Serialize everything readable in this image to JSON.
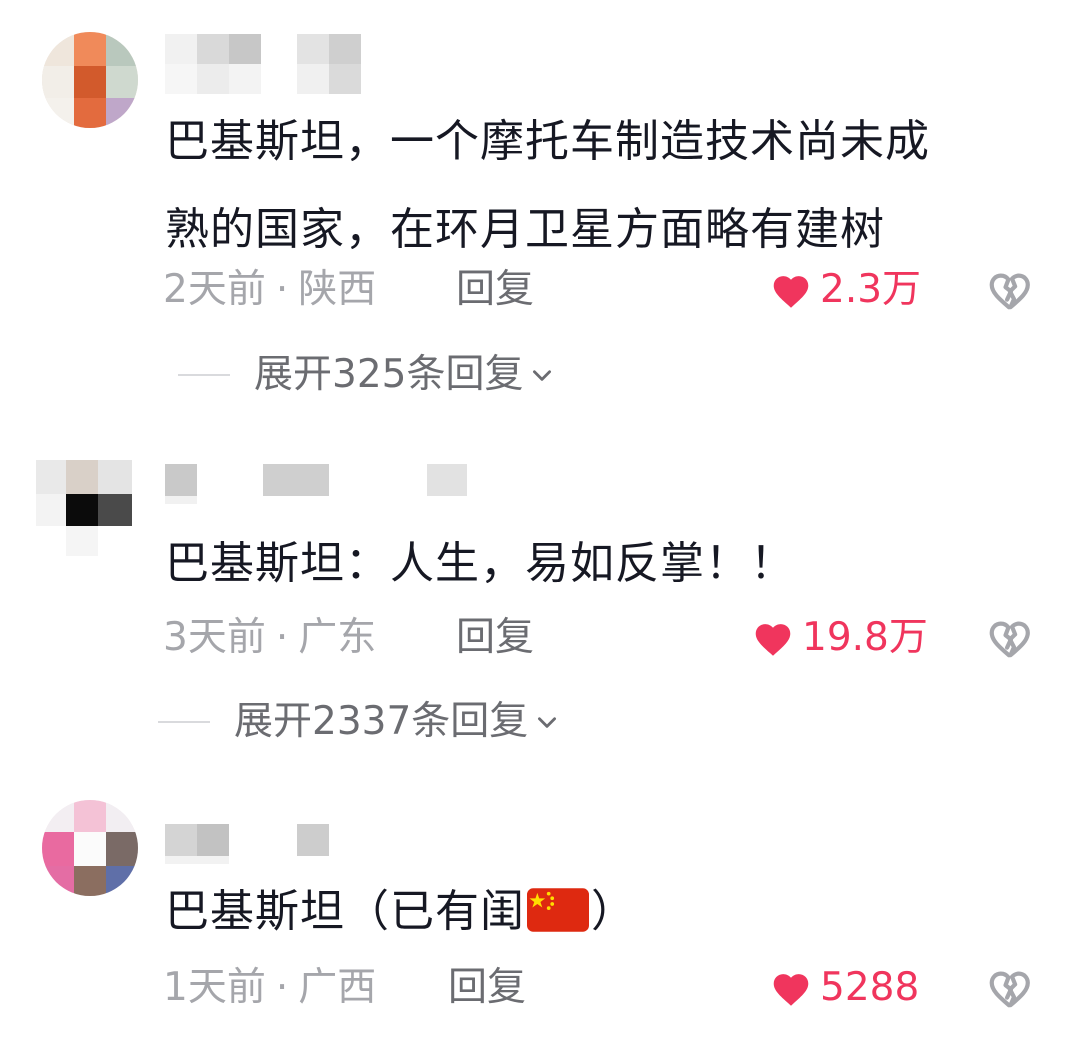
{
  "colors": {
    "like": "#f0355d",
    "meta": "#a5a6ab",
    "reply": "#6b6c71",
    "text": "#161823"
  },
  "comments": [
    {
      "content_lines": [
        "巴基斯坦，一个摩托车制造技术尚未成",
        "熟的国家，在环月卫星方面略有建树"
      ],
      "time": "2天前",
      "separator": "·",
      "location": "陕西",
      "reply_label": "回复",
      "likes": "2.3万",
      "expand_label": "展开325条回复",
      "like_icon": "heart-icon",
      "dislike_icon": "broken-heart-icon"
    },
    {
      "content_lines": [
        "巴基斯坦：人生，易如反掌！！"
      ],
      "time": "3天前",
      "separator": "·",
      "location": "广东",
      "reply_label": "回复",
      "likes": "19.8万",
      "expand_label": "展开2337条回复",
      "like_icon": "heart-icon",
      "dislike_icon": "broken-heart-icon"
    },
    {
      "content_prefix": "巴基斯坦（已有闺",
      "content_suffix": "）",
      "content_emoji": "china-flag-emoji",
      "time": "1天前",
      "separator": "·",
      "location": "广西",
      "reply_label": "回复",
      "likes": "5288",
      "like_icon": "heart-icon",
      "dislike_icon": "broken-heart-icon"
    }
  ]
}
